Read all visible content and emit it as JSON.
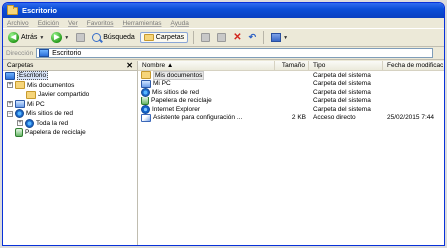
{
  "window": {
    "title": "Escritorio"
  },
  "menu": [
    "Archivo",
    "Edición",
    "Ver",
    "Favoritos",
    "Herramientas",
    "Ayuda"
  ],
  "toolbar": {
    "back_label": "Atrás",
    "search_label": "Búsqueda",
    "folders_label": "Carpetas"
  },
  "address": {
    "label": "Dirección",
    "value": "Escritorio"
  },
  "tree": {
    "header": "Carpetas",
    "close_glyph": "✕",
    "items": [
      {
        "label": "Escritorio",
        "icon": "desktop-icon",
        "expander": "",
        "selected": true
      },
      {
        "label": "Mis documentos",
        "icon": "documents-folder-icon",
        "expander": "+"
      },
      {
        "label": "Javier compartido",
        "icon": "folder-icon",
        "expander": ""
      },
      {
        "label": "Mi PC",
        "icon": "computer-icon",
        "expander": "+"
      },
      {
        "label": "Mis sitios de red",
        "icon": "network-icon",
        "expander": "−"
      },
      {
        "label": "Toda la red",
        "icon": "network-icon",
        "expander": "+"
      },
      {
        "label": "Papelera de reciclaje",
        "icon": "recycle-bin-icon",
        "expander": ""
      }
    ]
  },
  "list": {
    "columns": {
      "name": "Nombre ▲",
      "size": "Tamaño",
      "type": "Tipo",
      "date": "Fecha de modificación"
    },
    "rows": [
      {
        "name": "Mis documentos",
        "size": "",
        "type": "Carpeta del sistema",
        "date": "",
        "icon": "documents-folder-icon",
        "selected": true
      },
      {
        "name": "Mi PC",
        "size": "",
        "type": "Carpeta del sistema",
        "date": "",
        "icon": "computer-icon"
      },
      {
        "name": "Mis sitios de red",
        "size": "",
        "type": "Carpeta del sistema",
        "date": "",
        "icon": "network-icon"
      },
      {
        "name": "Papelera de reciclaje",
        "size": "",
        "type": "Carpeta del sistema",
        "date": "",
        "icon": "recycle-bin-icon"
      },
      {
        "name": "Internet Explorer",
        "size": "",
        "type": "Carpeta del sistema",
        "date": "",
        "icon": "internet-explorer-icon"
      },
      {
        "name": "Asistente para configuración ...",
        "size": "2 KB",
        "type": "Acceso directo",
        "date": "25/02/2015 7:44",
        "icon": "wizard-shortcut-icon"
      }
    ]
  }
}
